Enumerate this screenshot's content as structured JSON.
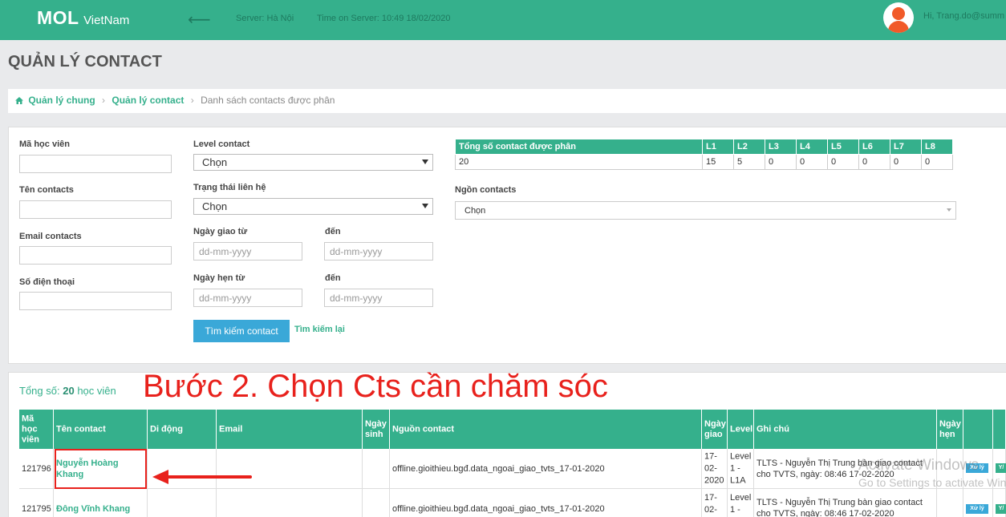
{
  "header": {
    "logo_main": "MOL",
    "logo_sub": "VietNam",
    "back_glyph": "⟵",
    "server": "Server: Hà Nội",
    "server_time": "Time on Server: 10:49 18/02/2020",
    "user_greeting": "Hi, Trang.do@summ"
  },
  "page_title": "QUẢN LÝ CONTACT",
  "breadcrumb": {
    "items": [
      "Quản lý chung",
      "Quản lý contact",
      "Danh sách contacts được phân"
    ],
    "separator": "›"
  },
  "filters": {
    "student_id_label": "Mã học viên",
    "contact_name_label": "Tên contacts",
    "email_label": "Email contacts",
    "phone_label": "Số điện thoại",
    "level_label": "Level contact",
    "level_value": "Chọn",
    "status_label": "Trạng thái liên hệ",
    "status_value": "Chọn",
    "assign_from_label": "Ngày giao từ",
    "assign_to_label": "đến",
    "appt_from_label": "Ngày hẹn từ",
    "appt_to_label": "đến",
    "date_placeholder": "dd-mm-yyyy",
    "search_button": "Tìm kiếm contact",
    "reset_link": "Tìm kiếm lại",
    "source_label": "Ngồn contacts",
    "source_value": "Chọn"
  },
  "stats": {
    "headers": [
      "Tổng số contact được phân",
      "L1",
      "L2",
      "L3",
      "L4",
      "L5",
      "L6",
      "L7",
      "L8"
    ],
    "values": [
      "20",
      "15",
      "5",
      "0",
      "0",
      "0",
      "0",
      "0",
      "0"
    ]
  },
  "results": {
    "total_prefix": "Tổng số:",
    "total_count": "20",
    "total_suffix": "học viên",
    "annotation": "Bước 2. Chọn Cts cần chăm sóc",
    "columns": [
      "Mã học viên",
      "Tên contact",
      "Di động",
      "Email",
      "Ngày sinh",
      "Nguồn contact",
      "Ngày giao",
      "Level",
      "Ghi chú",
      "Ngày hẹn"
    ],
    "rows": [
      {
        "id": "121796",
        "name": "Nguyễn Hoàng Khang",
        "mobile": "",
        "email": "",
        "dob": "",
        "source": "offline.gioithieu.bgđ.data_ngoai_giao_tvts_17-01-2020",
        "assigned": "17-02-2020",
        "level": "Level 1 - L1A",
        "note": "TLTS - Nguyễn Thị Trung bàn giao contact cho TVTS, ngày: 08:46 17-02-2020",
        "appointment": "",
        "action_process": "Xử lý",
        "action_y": "Y/"
      },
      {
        "id": "121795",
        "name": "Đông Vĩnh Khang",
        "mobile": "",
        "email": "",
        "dob": "",
        "source": "offline.gioithieu.bgđ.data_ngoai_giao_tvts_17-01-2020",
        "assigned": "17-02-",
        "level": "Level 1 -",
        "note": "TLTS - Nguyễn Thị Trung bàn giao contact cho TVTS, ngày: 08:46 17-02-2020",
        "appointment": "",
        "action_process": "Xử lý",
        "action_y": "Y/"
      }
    ]
  },
  "watermark": {
    "line1": "Activate Windows",
    "line2": "Go to Settings to activate Windows."
  }
}
